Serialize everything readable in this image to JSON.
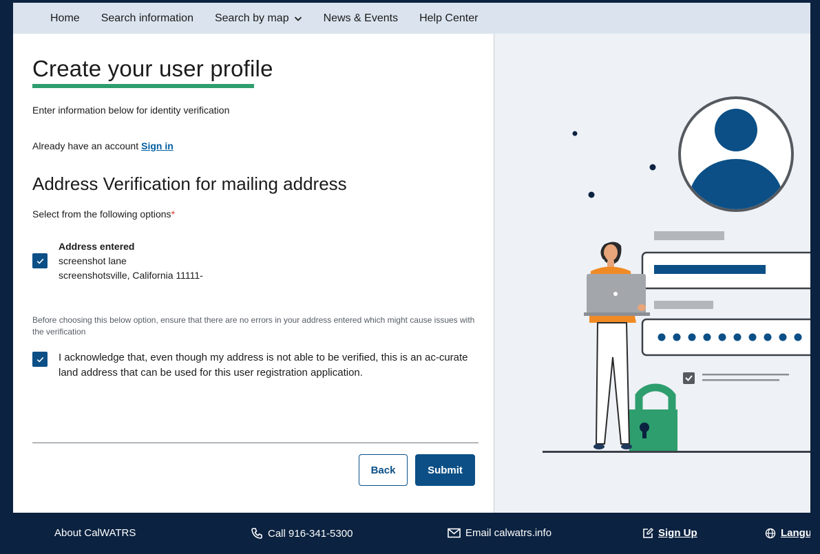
{
  "nav": {
    "items": [
      {
        "label": "Home"
      },
      {
        "label": "Search information"
      },
      {
        "label": "Search by map"
      },
      {
        "label": "News & Events"
      },
      {
        "label": "Help Center"
      }
    ]
  },
  "page": {
    "title": "Create your user profile",
    "intro": "Enter information below for identity verification",
    "account_prompt": "Already have an account",
    "sign_in_link": "Sign in",
    "section_title": "Address Verification for mailing address",
    "select_label": "Select from the following options",
    "required_mark": "*"
  },
  "address_option": {
    "checked": true,
    "title": "Address entered",
    "line1": "screenshot lane",
    "line2": "screenshotsville, California 11111-"
  },
  "note": "Before choosing this below option, ensure that there are no errors in your address entered which might cause issues with the verification",
  "acknowledge_option": {
    "checked": true,
    "text": "I acknowledge that, even though my address is not able to be verified, this is an ac-curate land address that can be used for this user registration application."
  },
  "buttons": {
    "back": "Back",
    "submit": "Submit"
  },
  "footer": {
    "about": "About CalWATRS",
    "call": "Call 916-341-5300",
    "email": "Email calwatrs.info",
    "signup": "Sign Up",
    "language": "Langu"
  },
  "colors": {
    "primary": "#0b4f86",
    "accent_green": "#2e9e6e",
    "nav_bg": "#dbe4ee",
    "footer_bg": "#0b2240",
    "link": "#005ea2"
  }
}
